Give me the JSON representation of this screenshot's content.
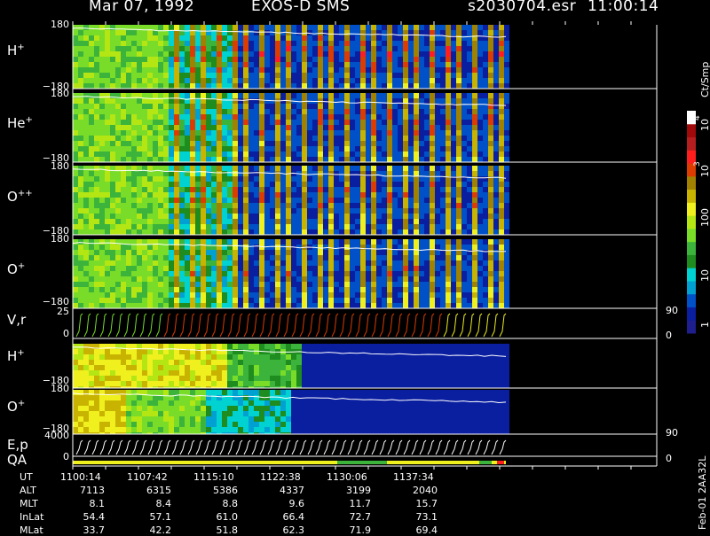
{
  "header": {
    "date": "Mar 07, 1992",
    "instrument": "EXOS-D SMS",
    "file": "s2030704.esr",
    "time": "11:00:14"
  },
  "colors": {
    "background": "#000000",
    "colorbar": [
      "#1e1e8c",
      "#0a1ea0",
      "#0050c8",
      "#00a0d2",
      "#00d2d2",
      "#1e8c1e",
      "#3cb43c",
      "#78dc28",
      "#b4e614",
      "#f0f01e",
      "#c8b400",
      "#a08200",
      "#dc3c00",
      "#ff1e1e",
      "#b41e1e",
      "#a00a0a",
      "#ffffff"
    ]
  },
  "colorbar": {
    "unit_label": "Ct/Smp",
    "tick_labels": [
      "1",
      "10",
      "100",
      "10",
      "3",
      "10",
      "4"
    ]
  },
  "panels": [
    {
      "label": "H",
      "sup": "+",
      "ymax": "180",
      "ymin": "−180"
    },
    {
      "label": "He",
      "sup": "+",
      "ymax": "180",
      "ymin": "−180"
    },
    {
      "label": "O",
      "sup": "++",
      "ymax": "180",
      "ymin": "−180"
    },
    {
      "label": "O",
      "sup": "+",
      "ymax": "180",
      "ymin": "−180"
    },
    {
      "label": "V,r",
      "sup": "",
      "ymax": "25",
      "ymin": "0"
    },
    {
      "label": "H",
      "sup": "+",
      "ymax": "",
      "ymin": "−180"
    },
    {
      "label": "O",
      "sup": "+",
      "ymax": "180",
      "ymin": "−180"
    },
    {
      "label": "E,p",
      "sup": "",
      "ymax": "4000",
      "ymin": "0"
    }
  ],
  "qa_label": "QA",
  "right_ticks": {
    "vr_top": "90",
    "vr_bottom": "0",
    "ep_top": "90",
    "ep_bottom": "0"
  },
  "side_label": "Feb-01 2AA32L",
  "orbit_table": {
    "row_labels": [
      "UT",
      "ALT",
      "MLT",
      "InLat",
      "MLat"
    ],
    "columns": [
      [
        "1100:14",
        "7113",
        "8.1",
        "54.4",
        "33.7"
      ],
      [
        "1107:42",
        "6315",
        "8.4",
        "57.1",
        "42.2"
      ],
      [
        "1115:10",
        "5386",
        "8.8",
        "61.0",
        "51.8"
      ],
      [
        "1122:38",
        "4337",
        "9.6",
        "66.4",
        "62.3"
      ],
      [
        "1130:06",
        "3199",
        "11.7",
        "72.7",
        "71.9"
      ],
      [
        "1137:34",
        "2040",
        "15.7",
        "73.1",
        "69.4"
      ]
    ]
  },
  "chart_data": {
    "type": "heatmap",
    "title": "Mar 07, 1992   EXOS-D SMS",
    "x_axis": "UT",
    "x_range": [
      "1100:14",
      "1142:00"
    ],
    "colorscale": {
      "unit": "Ct/Smp",
      "scale": "log",
      "range": [
        1,
        10000
      ]
    },
    "panels": [
      {
        "name": "H+",
        "yrange": [
          -180,
          180
        ],
        "ylabel": "H+"
      },
      {
        "name": "He+",
        "yrange": [
          -180,
          180
        ],
        "ylabel": "He+"
      },
      {
        "name": "O++",
        "yrange": [
          -180,
          180
        ],
        "ylabel": "O++"
      },
      {
        "name": "O+",
        "yrange": [
          -180,
          180
        ],
        "ylabel": "O+"
      },
      {
        "name": "V,r",
        "yrange": [
          0,
          25
        ],
        "ylabel": "V,r",
        "right_range": [
          0,
          90
        ]
      },
      {
        "name": "H+",
        "yrange": [
          -180,
          180
        ],
        "ylabel": "H+"
      },
      {
        "name": "O+",
        "yrange": [
          -180,
          180
        ],
        "ylabel": "O+"
      },
      {
        "name": "E,p",
        "yrange": [
          0,
          4000
        ],
        "ylabel": "E,p",
        "right_range": [
          0,
          90
        ]
      }
    ]
  }
}
